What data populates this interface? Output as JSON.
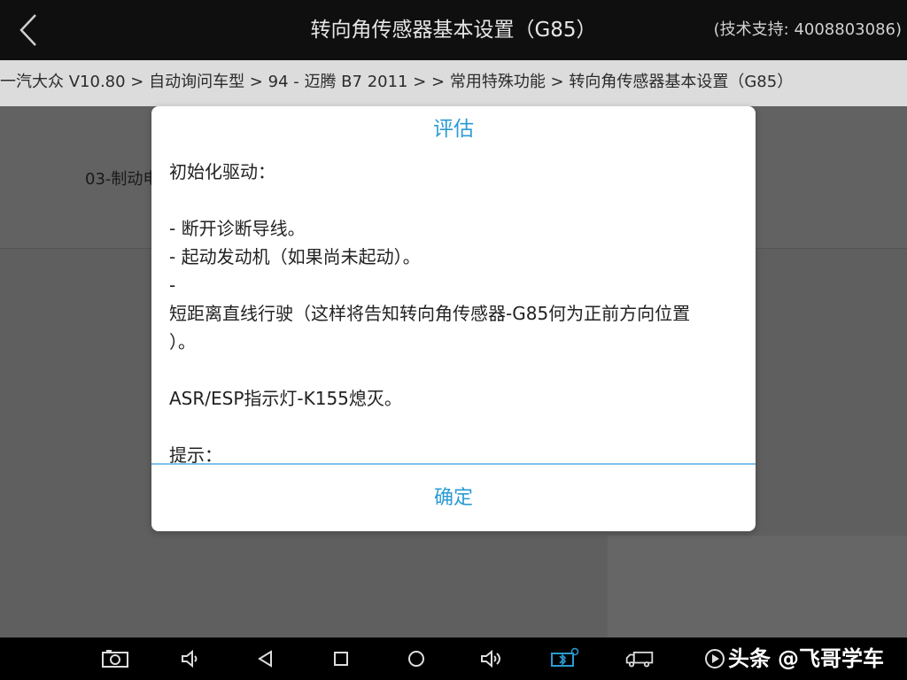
{
  "header": {
    "title": "转向角传感器基本设置（G85）",
    "support": "(技术支持: 4008803086)"
  },
  "breadcrumb": {
    "text": "一汽大众 V10.80 > 自动询问车型 > 94 - 迈腾 B7 2011 > > 常用特殊功能 > 转向角传感器基本设置（G85）"
  },
  "background": {
    "row_label": "03-制动电"
  },
  "dialog": {
    "title": "评估",
    "lines": [
      "初始化驱动：",
      "",
      "- 断开诊断导线。",
      "- 起动发动机（如果尚未起动）。",
      "-",
      "短距离直线行驶（这样将告知转向角传感器-G85何为正前方向位置",
      "）。",
      "",
      "ASR/ESP指示灯-K155熄灭。",
      "",
      "提示："
    ],
    "ok_label": "确定"
  },
  "navbar": {
    "icons": [
      "screenshot-icon",
      "volume-down-icon",
      "back-triangle-icon",
      "recents-square-icon",
      "home-circle-icon",
      "volume-up-icon",
      "vci-bluetooth-icon",
      "truck-icon",
      "play-icon"
    ],
    "accent": "#2a9bd3"
  },
  "watermark": {
    "brand": "头条",
    "handle": "@飞哥学车"
  },
  "colors": {
    "accent": "#2a9bd3",
    "topbar": "#0f0f0f"
  }
}
